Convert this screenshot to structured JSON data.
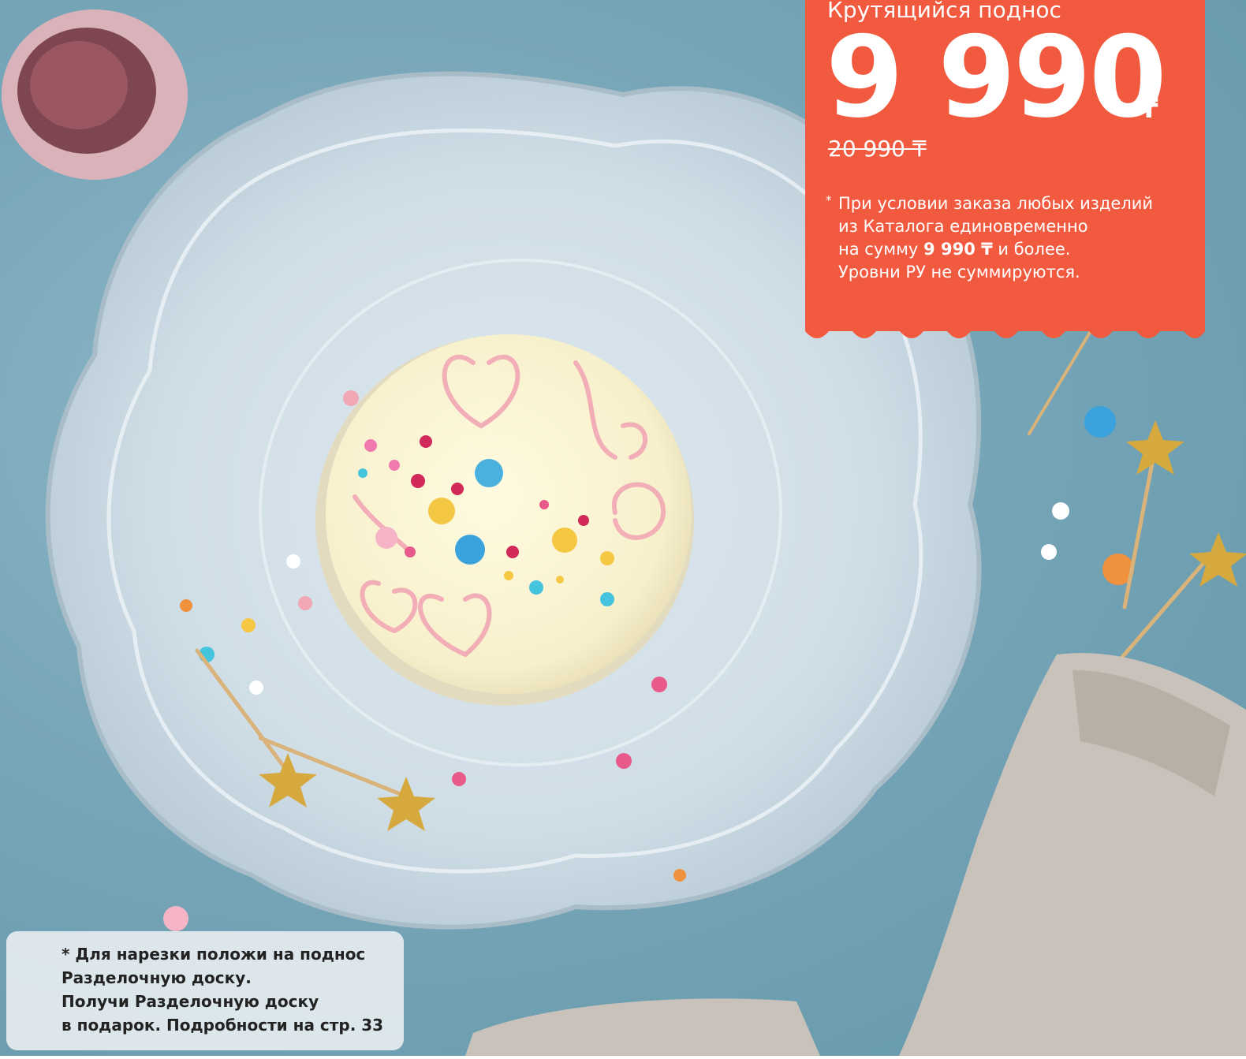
{
  "promo": {
    "product_name": "Крутящийся поднос",
    "price": "9 990",
    "currency": "₸",
    "old_price": "20 990 ₸",
    "condition": {
      "asterisk": "*",
      "line1": "При условии заказа любых изделий",
      "line2": "из Каталога единовременно",
      "line3_prefix": "на сумму ",
      "line3_amount": "9 990 ₸",
      "line3_suffix": " и более.",
      "line4": "Уровни РУ не суммируются."
    },
    "card_color": "#f15a3f"
  },
  "note": {
    "line1": "* Для нарезки положи на поднос",
    "line2": "Разделочную доску.",
    "line3": "Получи Разделочную доску",
    "line4": "в подарок. Подробности на стр. 33"
  }
}
